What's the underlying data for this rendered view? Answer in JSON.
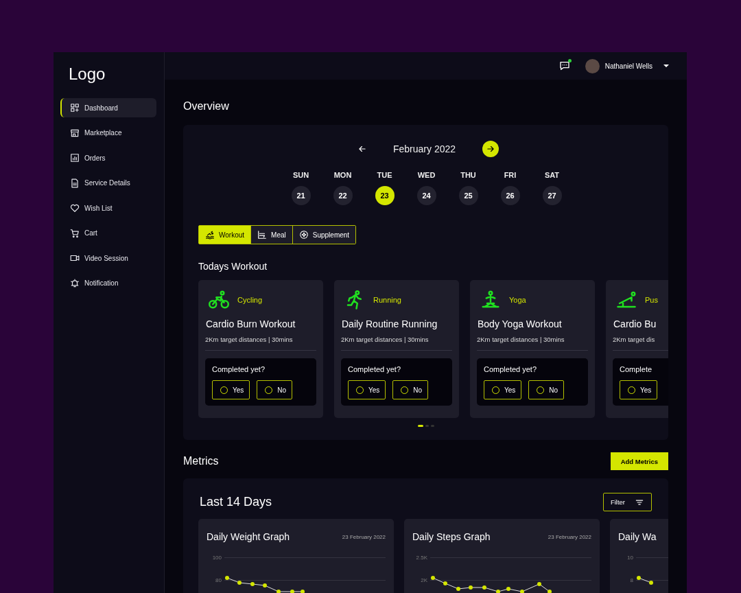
{
  "sidebar": {
    "logo": "Logo",
    "items": [
      {
        "label": "Dashboard",
        "selected": true
      },
      {
        "label": "Marketplace",
        "selected": false
      },
      {
        "label": "Orders",
        "selected": false
      },
      {
        "label": "Service Details",
        "selected": false
      },
      {
        "label": "Wish List",
        "selected": false
      },
      {
        "label": "Cart",
        "selected": false
      },
      {
        "label": "Video Session",
        "selected": false
      },
      {
        "label": "Notification",
        "selected": false
      }
    ]
  },
  "header": {
    "has_unread_messages": true,
    "user_name": "Nathaniel Wells"
  },
  "overview": {
    "title": "Overview",
    "month": "February 2022",
    "days": [
      {
        "weekday": "SUN",
        "date": "21",
        "selected": false
      },
      {
        "weekday": "MON",
        "date": "22",
        "selected": false
      },
      {
        "weekday": "TUE",
        "date": "23",
        "selected": true
      },
      {
        "weekday": "WED",
        "date": "24",
        "selected": false
      },
      {
        "weekday": "THU",
        "date": "25",
        "selected": false
      },
      {
        "weekday": "FRI",
        "date": "26",
        "selected": false
      },
      {
        "weekday": "SAT",
        "date": "27",
        "selected": false
      }
    ],
    "tabs": [
      {
        "label": "Workout",
        "selected": true
      },
      {
        "label": "Meal",
        "selected": false
      },
      {
        "label": "Supplement",
        "selected": false
      }
    ],
    "section_title": "Todays Workout",
    "workouts": [
      {
        "kind": "cycling",
        "category": "Cycling",
        "title": "Cardio Burn Workout",
        "details": "2Km target distances | 30mins",
        "question": "Completed yet?",
        "options": [
          {
            "label": "Yes",
            "selected": false
          },
          {
            "label": "No",
            "selected": false
          }
        ]
      },
      {
        "kind": "running",
        "category": "Running",
        "title": "Daily Routine Running",
        "details": "2Km target distances | 30mins",
        "question": "Completed yet?",
        "options": [
          {
            "label": "Yes",
            "selected": false
          },
          {
            "label": "No",
            "selected": false
          }
        ]
      },
      {
        "kind": "yoga",
        "category": "Yoga",
        "title": "Body Yoga Workout",
        "details": "2Km target distances | 30mins",
        "question": "Completed yet?",
        "options": [
          {
            "label": "Yes",
            "selected": false
          },
          {
            "label": "No",
            "selected": false
          }
        ]
      },
      {
        "kind": "pushup",
        "category": "Pus",
        "title": "Cardio Bu",
        "details": "2Km target dis",
        "question": "Complete",
        "options": [
          {
            "label": "Yes",
            "selected": false
          }
        ]
      }
    ],
    "pages": [
      {
        "selected": true
      },
      {
        "selected": false
      },
      {
        "selected": false
      }
    ]
  },
  "metrics": {
    "title": "Metrics",
    "add_button": "Add Metrics",
    "panel_title": "Last 14 Days",
    "filter_button": "Filter",
    "graphs": [
      {
        "title": "Daily Weight Graph",
        "date": "23 February 2022",
        "ticks": [
          "100",
          "80"
        ]
      },
      {
        "title": "Daily Steps Graph",
        "date": "23 February 2022",
        "ticks": [
          "2.5K",
          "2K"
        ]
      },
      {
        "title": "Daily Wa",
        "ticks": [
          "10",
          "8"
        ]
      }
    ]
  }
}
